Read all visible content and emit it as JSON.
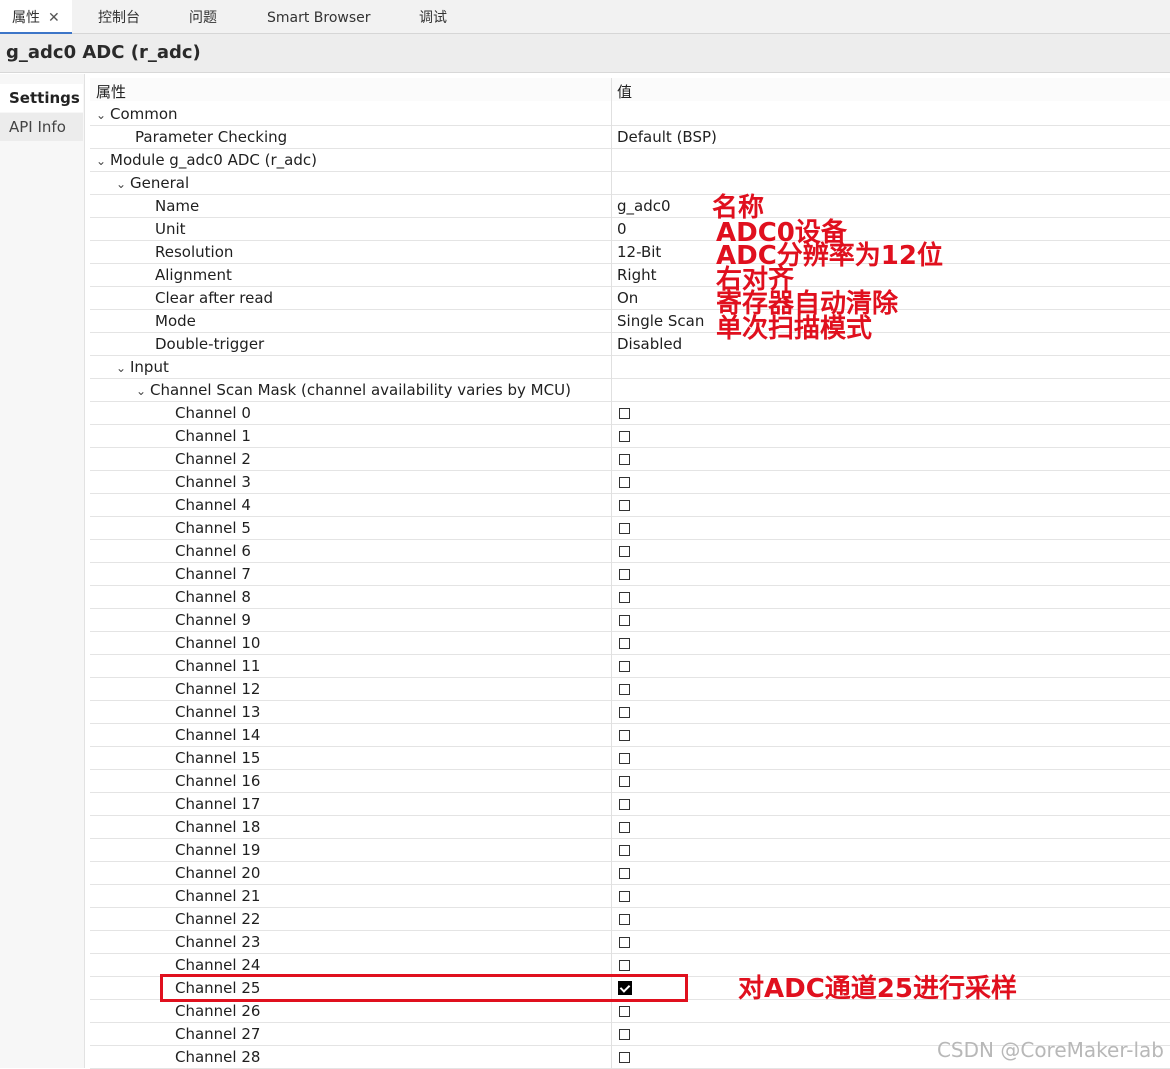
{
  "tabs": [
    {
      "label": "属性",
      "closable": true,
      "active": true
    },
    {
      "label": "控制台"
    },
    {
      "label": "问题"
    },
    {
      "label": "Smart Browser"
    },
    {
      "label": "调试"
    }
  ],
  "title": "g_adc0 ADC (r_adc)",
  "left_tabs": [
    {
      "label": "Settings",
      "active": true
    },
    {
      "label": "API Info"
    }
  ],
  "table": {
    "header_property": "属性",
    "header_value": "值",
    "rows": [
      {
        "level": 0,
        "expandable": true,
        "label": "Common",
        "value": ""
      },
      {
        "level": 1,
        "label": "Parameter Checking",
        "value": "Default (BSP)"
      },
      {
        "level": 0,
        "expandable": true,
        "label": "Module g_adc0 ADC (r_adc)",
        "value": ""
      },
      {
        "level": 1,
        "expandable": true,
        "label": "General",
        "value": ""
      },
      {
        "level": 2,
        "label": "Name",
        "value": "g_adc0"
      },
      {
        "level": 2,
        "label": "Unit",
        "value": "0"
      },
      {
        "level": 2,
        "label": "Resolution",
        "value": "12-Bit"
      },
      {
        "level": 2,
        "label": "Alignment",
        "value": "Right"
      },
      {
        "level": 2,
        "label": "Clear after read",
        "value": "On"
      },
      {
        "level": 2,
        "label": "Mode",
        "value": "Single Scan"
      },
      {
        "level": 2,
        "label": "Double-trigger",
        "value": "Disabled"
      },
      {
        "level": 1,
        "expandable": true,
        "label": "Input",
        "value": ""
      },
      {
        "level": 2,
        "expandable": true,
        "label": "Channel Scan Mask (channel availability varies by MCU)",
        "value": ""
      },
      {
        "level": 3,
        "label": "Channel 0",
        "checkbox": true,
        "checked": false
      },
      {
        "level": 3,
        "label": "Channel 1",
        "checkbox": true,
        "checked": false
      },
      {
        "level": 3,
        "label": "Channel 2",
        "checkbox": true,
        "checked": false
      },
      {
        "level": 3,
        "label": "Channel 3",
        "checkbox": true,
        "checked": false
      },
      {
        "level": 3,
        "label": "Channel 4",
        "checkbox": true,
        "checked": false
      },
      {
        "level": 3,
        "label": "Channel 5",
        "checkbox": true,
        "checked": false
      },
      {
        "level": 3,
        "label": "Channel 6",
        "checkbox": true,
        "checked": false
      },
      {
        "level": 3,
        "label": "Channel 7",
        "checkbox": true,
        "checked": false
      },
      {
        "level": 3,
        "label": "Channel 8",
        "checkbox": true,
        "checked": false
      },
      {
        "level": 3,
        "label": "Channel 9",
        "checkbox": true,
        "checked": false
      },
      {
        "level": 3,
        "label": "Channel 10",
        "checkbox": true,
        "checked": false
      },
      {
        "level": 3,
        "label": "Channel 11",
        "checkbox": true,
        "checked": false
      },
      {
        "level": 3,
        "label": "Channel 12",
        "checkbox": true,
        "checked": false
      },
      {
        "level": 3,
        "label": "Channel 13",
        "checkbox": true,
        "checked": false
      },
      {
        "level": 3,
        "label": "Channel 14",
        "checkbox": true,
        "checked": false
      },
      {
        "level": 3,
        "label": "Channel 15",
        "checkbox": true,
        "checked": false
      },
      {
        "level": 3,
        "label": "Channel 16",
        "checkbox": true,
        "checked": false
      },
      {
        "level": 3,
        "label": "Channel 17",
        "checkbox": true,
        "checked": false
      },
      {
        "level": 3,
        "label": "Channel 18",
        "checkbox": true,
        "checked": false
      },
      {
        "level": 3,
        "label": "Channel 19",
        "checkbox": true,
        "checked": false
      },
      {
        "level": 3,
        "label": "Channel 20",
        "checkbox": true,
        "checked": false
      },
      {
        "level": 3,
        "label": "Channel 21",
        "checkbox": true,
        "checked": false
      },
      {
        "level": 3,
        "label": "Channel 22",
        "checkbox": true,
        "checked": false
      },
      {
        "level": 3,
        "label": "Channel 23",
        "checkbox": true,
        "checked": false
      },
      {
        "level": 3,
        "label": "Channel 24",
        "checkbox": true,
        "checked": false
      },
      {
        "level": 3,
        "label": "Channel 25",
        "checkbox": true,
        "checked": true,
        "highlighted": true
      },
      {
        "level": 3,
        "label": "Channel 26",
        "checkbox": true,
        "checked": false
      },
      {
        "level": 3,
        "label": "Channel 27",
        "checkbox": true,
        "checked": false
      },
      {
        "level": 3,
        "label": "Channel 28",
        "checkbox": true,
        "checked": false
      }
    ]
  },
  "annotations": {
    "color": "#e0101e",
    "name": "名称",
    "unit": "ADC0设备",
    "resolution": "ADC分辨率为12位",
    "alignment": "右对齐",
    "clear": "寄存器自动清除",
    "mode": "单次扫描模式",
    "channel": "对ADC通道25进行采样"
  },
  "watermark": "CSDN @CoreMaker-lab"
}
